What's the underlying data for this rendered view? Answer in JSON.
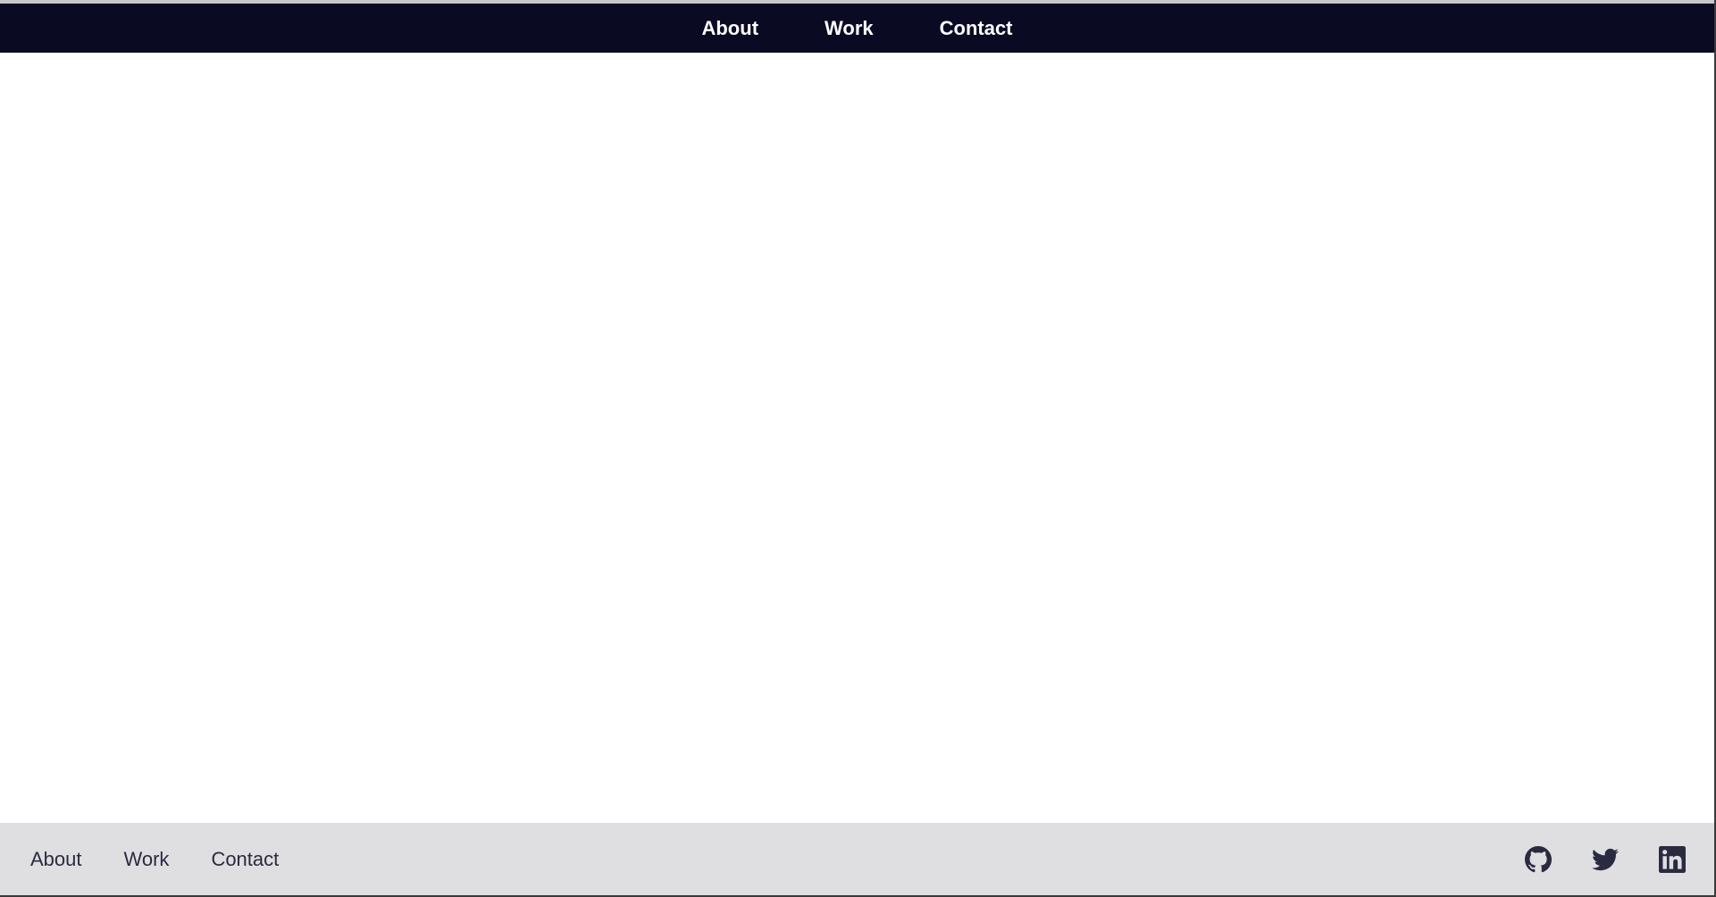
{
  "header": {
    "nav": [
      {
        "label": "About"
      },
      {
        "label": "Work"
      },
      {
        "label": "Contact"
      }
    ]
  },
  "footer": {
    "nav": [
      {
        "label": "About"
      },
      {
        "label": "Work"
      },
      {
        "label": "Contact"
      }
    ],
    "social": [
      {
        "icon": "github-icon"
      },
      {
        "icon": "twitter-icon"
      },
      {
        "icon": "linkedin-icon"
      }
    ]
  },
  "colors": {
    "header_bg": "#0a0a23",
    "header_text": "#ffffff",
    "footer_bg": "#dfdfe2",
    "footer_text": "#2a2a40",
    "page_bg": "#ffffff"
  }
}
